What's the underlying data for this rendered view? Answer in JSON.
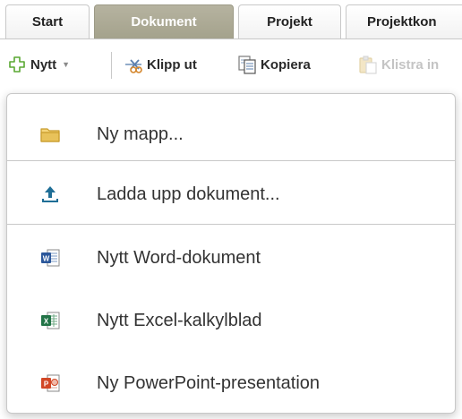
{
  "tabs": [
    {
      "label": "Start",
      "active": false
    },
    {
      "label": "Dokument",
      "active": true
    },
    {
      "label": "Projekt",
      "active": false
    },
    {
      "label": "Projektkon",
      "active": false
    }
  ],
  "toolbar": {
    "new_label": "Nytt",
    "cut_label": "Klipp ut",
    "copy_label": "Kopiera",
    "paste_label": "Klistra in"
  },
  "menu": {
    "items": [
      {
        "label": "Ny mapp...",
        "icon": "folder-icon"
      },
      {
        "label": "Ladda upp dokument...",
        "icon": "upload-icon"
      },
      {
        "label": "Nytt Word-dokument",
        "icon": "word-icon"
      },
      {
        "label": "Nytt Excel-kalkylblad",
        "icon": "excel-icon"
      },
      {
        "label": "Ny PowerPoint-presentation",
        "icon": "powerpoint-icon"
      }
    ]
  },
  "colors": {
    "active_tab": "#a9a792",
    "new_plus": "#5aa832",
    "upload": "#1f6e96",
    "word": "#2b579a",
    "excel": "#217346",
    "powerpoint": "#d24726",
    "folder": "#e8c25a"
  }
}
